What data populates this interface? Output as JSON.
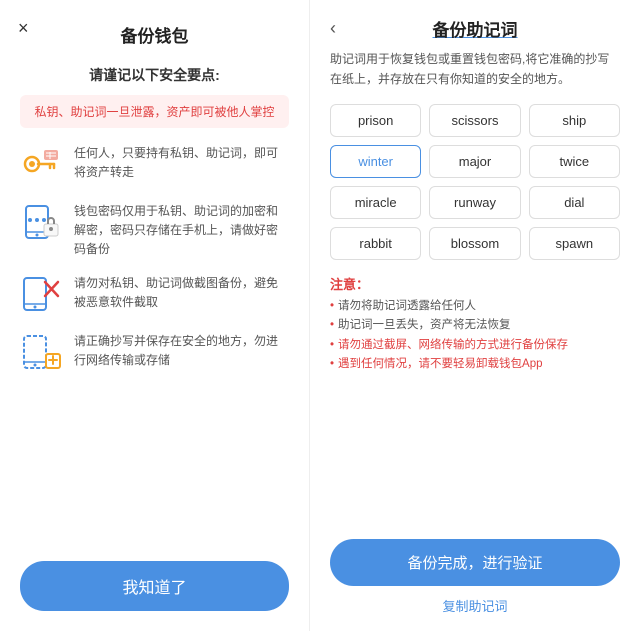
{
  "left": {
    "close_icon": "×",
    "title": "备份钱包",
    "subtitle": "请谨记以下安全要点:",
    "warning": "私钥、助记词一旦泄露，资产即可被他人掌控",
    "features": [
      {
        "text": "任何人，只要持有私钥、助记词，即可将资产转走"
      },
      {
        "text": "钱包密码仅用于私钥、助记词的加密和解密，密码只存储在手机上，请做好密码备份"
      },
      {
        "text": "请勿对私钥、助记词做截图备份，避免被恶意软件截取"
      },
      {
        "text": "请正确抄写并保存在安全的地方，勿进行网络传输或存储"
      }
    ],
    "btn_label": "我知道了"
  },
  "right": {
    "back_icon": "‹",
    "title": "备份助记词",
    "desc": "助记词用于恢复钱包或重置钱包密码,将它准确的抄写在纸上，并存放在只有你知道的安全的地方。",
    "words": [
      {
        "word": "prison",
        "highlight": false
      },
      {
        "word": "scissors",
        "highlight": false
      },
      {
        "word": "ship",
        "highlight": false
      },
      {
        "word": "winter",
        "highlight": true
      },
      {
        "word": "major",
        "highlight": false
      },
      {
        "word": "twice",
        "highlight": false
      },
      {
        "word": "miracle",
        "highlight": false
      },
      {
        "word": "runway",
        "highlight": false
      },
      {
        "word": "dial",
        "highlight": false
      },
      {
        "word": "rabbit",
        "highlight": false
      },
      {
        "word": "blossom",
        "highlight": false
      },
      {
        "word": "spawn",
        "highlight": false
      }
    ],
    "notes_title": "注意：",
    "notes": [
      {
        "text": "请勿将助记词透露给任何人",
        "red": false
      },
      {
        "text": "助记词一旦丢失，资产将无法恢复",
        "red": false
      },
      {
        "text": "请勿通过截屏、网络传输的方式进行备份保存",
        "red": true
      },
      {
        "text": "遇到任何情况，请不要轻易卸载钱包App",
        "red": true
      }
    ],
    "verify_btn": "备份完成，进行验证",
    "copy_label": "复制助记词"
  }
}
